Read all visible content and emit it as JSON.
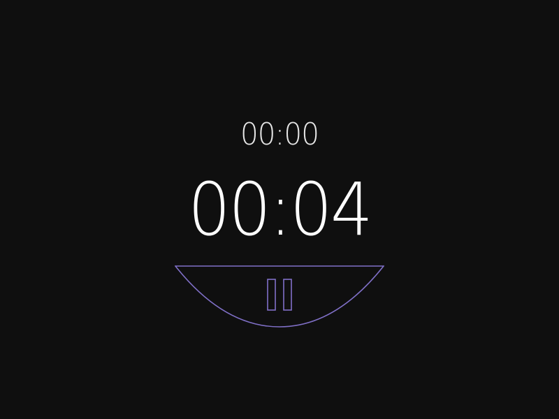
{
  "timer": {
    "lap_time": "00:00",
    "elapsed_time": "00:04"
  },
  "controls": {
    "pause_icon": "pause-icon"
  },
  "colors": {
    "background": "#0f0f0f",
    "text": "#ffffff",
    "accent": "#8070c8"
  }
}
